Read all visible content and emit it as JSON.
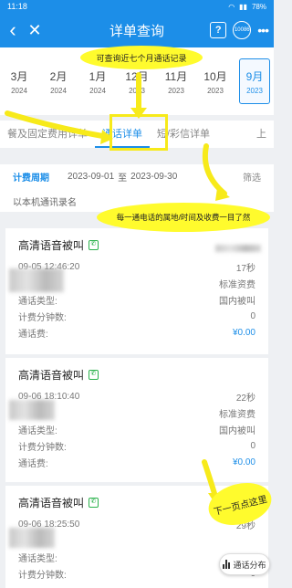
{
  "status": {
    "time": "11:18",
    "battery": "78%"
  },
  "header": {
    "title": "详单查询",
    "help_icon": "?",
    "cs_label": "10086"
  },
  "months": [
    {
      "m": "3月",
      "y": "2024"
    },
    {
      "m": "2月",
      "y": "2024"
    },
    {
      "m": "1月",
      "y": "2024"
    },
    {
      "m": "12月",
      "y": "2023"
    },
    {
      "m": "11月",
      "y": "2023"
    },
    {
      "m": "10月",
      "y": "2023"
    },
    {
      "m": "9月",
      "y": "2023"
    }
  ],
  "tabs": [
    "餐及固定费用详单",
    "通话详单",
    "短/彩信详单",
    "上"
  ],
  "period": {
    "label": "计费周期",
    "start": "2023-09-01",
    "to": "至",
    "end": "2023-09-30",
    "filter": "筛选"
  },
  "note": "以本机通讯录名",
  "records": [
    {
      "title": "高清语音被叫",
      "datetime": "09-05 12:46:20",
      "duration": "17秒",
      "plan": "标准资费",
      "type_label": "通话类型:",
      "type": "国内被叫",
      "min_label": "计费分钟数:",
      "minutes": "0",
      "fee_label": "通话费:",
      "fee": "¥0.00"
    },
    {
      "title": "高清语音被叫",
      "datetime": "09-06 18:10:40",
      "duration": "22秒",
      "plan": "标准资费",
      "type_label": "通话类型:",
      "type": "国内被叫",
      "min_label": "计费分钟数:",
      "minutes": "0",
      "fee_label": "通话费:",
      "fee": "¥0.00"
    },
    {
      "title": "高清语音被叫",
      "datetime": "09-06 18:25:50",
      "duration": "29秒",
      "plan": "",
      "type_label": "通话类型:",
      "type": "",
      "min_label": "计费分钟数:",
      "minutes": "0",
      "fee_label": "",
      "fee": ""
    }
  ],
  "float_button": "通话分布",
  "annotations": {
    "top": "可查询近七个月通话记录",
    "middle": "每一通电话的属地/时间及收费一目了然",
    "bottom": "下一页点这里"
  }
}
